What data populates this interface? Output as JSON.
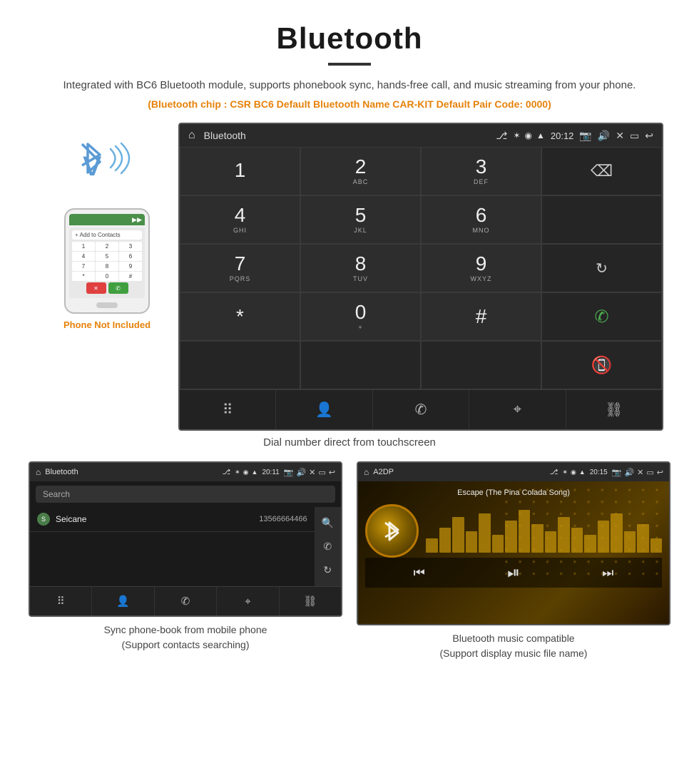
{
  "page": {
    "title": "Bluetooth",
    "subtitle": "Integrated with BC6 Bluetooth module, supports phonebook sync, hands-free call, and music streaming from your phone.",
    "spec_line": "(Bluetooth chip : CSR BC6    Default Bluetooth Name CAR-KIT    Default Pair Code: 0000)",
    "phone_not_included": "Phone Not Included",
    "dial_caption": "Dial number direct from touchscreen",
    "bt_screen": {
      "status_bar": {
        "title": "Bluetooth",
        "time": "20:12"
      },
      "dialpad": [
        {
          "num": "1",
          "sub": ""
        },
        {
          "num": "2",
          "sub": "ABC"
        },
        {
          "num": "3",
          "sub": "DEF"
        },
        {
          "num": "4",
          "sub": "GHI"
        },
        {
          "num": "5",
          "sub": "JKL"
        },
        {
          "num": "6",
          "sub": "MNO"
        },
        {
          "num": "7",
          "sub": "PQRS"
        },
        {
          "num": "8",
          "sub": "TUV"
        },
        {
          "num": "9",
          "sub": "WXYZ"
        },
        {
          "num": "*",
          "sub": ""
        },
        {
          "num": "0",
          "sub": "+"
        },
        {
          "num": "#",
          "sub": ""
        }
      ]
    }
  },
  "bottom_left": {
    "title": "Bluetooth",
    "time": "20:11",
    "search_placeholder": "Search",
    "contact_letter": "S",
    "contact_name": "Seicane",
    "contact_number": "13566664466",
    "caption_line1": "Sync phone-book from mobile phone",
    "caption_line2": "(Support contacts searching)"
  },
  "bottom_right": {
    "title": "A2DP",
    "time": "20:15",
    "song_title": "Escape (The Pina Colada Song)",
    "caption_line1": "Bluetooth music compatible",
    "caption_line2": "(Support display music file name)"
  },
  "colors": {
    "accent_orange": "#e6820a",
    "screen_bg": "#1a1a1a",
    "status_bar": "#2a2a2a",
    "dial_bg": "#2d2d2d",
    "green_call": "#4caf50",
    "red_call": "#f44336"
  },
  "phone_keys": [
    "1",
    "2",
    "3",
    "4",
    "5",
    "6",
    "7",
    "8",
    "9",
    "*",
    "0",
    "#"
  ],
  "eq_bar_heights": [
    20,
    35,
    50,
    30,
    55,
    25,
    45,
    60,
    40,
    30,
    50,
    35,
    25,
    45,
    55,
    30,
    40,
    20
  ]
}
